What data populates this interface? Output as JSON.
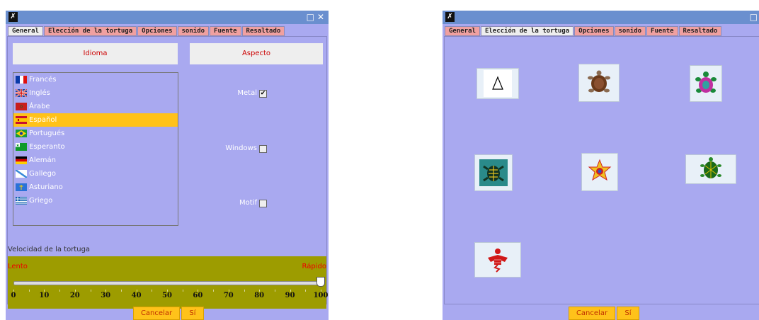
{
  "windows": [
    {
      "id": "general",
      "title_icon": "app-logo-icon",
      "controls": [
        "□",
        "✕"
      ],
      "tabs": [
        "General",
        "Elección de la tortuga",
        "Opciones",
        "sonido",
        "Fuente",
        "Resaltado"
      ],
      "active_tab": 0,
      "headers": {
        "language": "Idioma",
        "appearance": "Aspecto"
      },
      "languages": [
        {
          "label": "Francés",
          "flag": "fr-flag-icon"
        },
        {
          "label": "Inglés",
          "flag": "uk-flag-icon"
        },
        {
          "label": "Árabe",
          "flag": "ar-flag-icon"
        },
        {
          "label": "Español",
          "flag": "es-flag-icon",
          "selected": true
        },
        {
          "label": "Portugués",
          "flag": "br-flag-icon"
        },
        {
          "label": "Esperanto",
          "flag": "eo-flag-icon"
        },
        {
          "label": "Alemán",
          "flag": "de-flag-icon"
        },
        {
          "label": "Gallego",
          "flag": "gl-flag-icon"
        },
        {
          "label": "Asturiano",
          "flag": "ast-flag-icon"
        },
        {
          "label": "Griego",
          "flag": "gr-flag-icon"
        }
      ],
      "looks": [
        {
          "label": "Metal",
          "checked": true
        },
        {
          "label": "Windows",
          "checked": false
        },
        {
          "label": "Motif",
          "checked": false
        }
      ],
      "speed": {
        "label": "Velocidad de la tortuga",
        "slow": "Lento",
        "fast": "Rápido",
        "value": 100,
        "min": 0,
        "max": 100,
        "ticks": [
          "0",
          "10",
          "20",
          "30",
          "40",
          "50",
          "60",
          "70",
          "80",
          "90",
          "100"
        ]
      },
      "buttons": {
        "cancel": "Cancelar",
        "ok": "Sí"
      }
    },
    {
      "id": "turtle",
      "title_icon": "app-logo-icon",
      "controls": [
        "□"
      ],
      "tabs": [
        "General",
        "Elección de la tortuga",
        "Opciones",
        "sonido",
        "Fuente",
        "Resaltado"
      ],
      "active_tab": 1,
      "turtles": [
        {
          "icon": "triangle-turtle-icon"
        },
        {
          "icon": "brown-turtle-icon"
        },
        {
          "icon": "pink-green-turtle-icon"
        },
        {
          "icon": "dark-teal-turtle-icon"
        },
        {
          "icon": "yellow-star-turtle-icon"
        },
        {
          "icon": "green-shell-turtle-icon"
        },
        {
          "icon": "red-bird-turtle-icon"
        }
      ],
      "buttons": {
        "cancel": "Cancelar",
        "ok": "Sí"
      }
    }
  ],
  "colors": {
    "window_bg": "#a9a9f0",
    "titlebar": "#6a8fcf",
    "tab": "#f0a0a0",
    "selected_row": "#ffc21a",
    "speed_panel": "#9d9c00",
    "accent_red": "#cc0000"
  }
}
